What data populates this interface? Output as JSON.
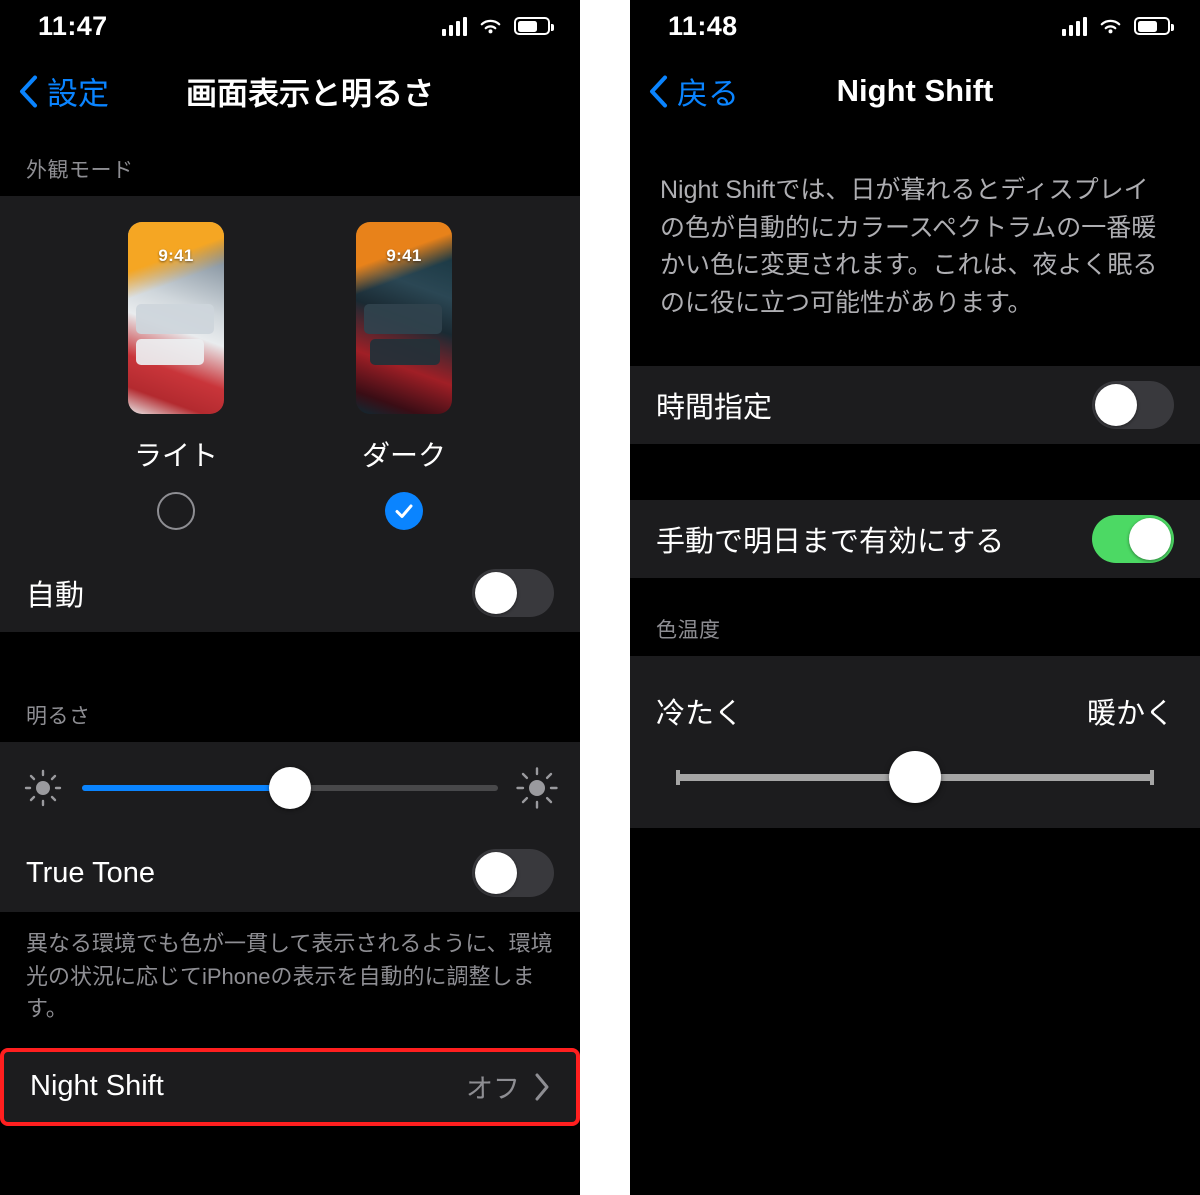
{
  "left": {
    "status": {
      "time": "11:47",
      "battery_level": 60
    },
    "nav": {
      "back_label": "設定",
      "title": "画面表示と明るさ"
    },
    "appearance": {
      "section_header": "外観モード",
      "options": [
        {
          "label": "ライト",
          "preview_time": "9:41",
          "selected": false
        },
        {
          "label": "ダーク",
          "preview_time": "9:41",
          "selected": true
        }
      ],
      "auto_label": "自動",
      "auto_on": false
    },
    "brightness": {
      "section_header": "明るさ",
      "value_percent": 50,
      "true_tone_label": "True Tone",
      "true_tone_on": false,
      "true_tone_note": "異なる環境でも色が一貫して表示されるように、環境光の状況に応じてiPhoneの表示を自動的に調整します。"
    },
    "night_shift_row": {
      "label": "Night Shift",
      "value": "オフ",
      "highlight_color": "#ff1f1f"
    }
  },
  "right": {
    "status": {
      "time": "11:48",
      "battery_level": 60
    },
    "nav": {
      "back_label": "戻る",
      "title": "Night Shift"
    },
    "description": "Night Shiftでは、日が暮れるとディスプレイの色が自動的にカラースペクトラムの一番暖かい色に変更されます。これは、夜よく眠るのに役に立つ可能性があります。",
    "scheduled_label": "時間指定",
    "scheduled_on": false,
    "manual_label": "手動で明日まで有効にする",
    "manual_on": true,
    "temperature": {
      "section_header": "色温度",
      "left_label": "冷たく",
      "right_label": "暖かく",
      "value_percent": 50
    }
  },
  "theme": {
    "accent_blue": "#0a84ff",
    "toggle_on_green": "#4cd964",
    "row_bg": "#1c1c1e",
    "page_bg": "#000000",
    "secondary_text": "#8e8e93"
  }
}
